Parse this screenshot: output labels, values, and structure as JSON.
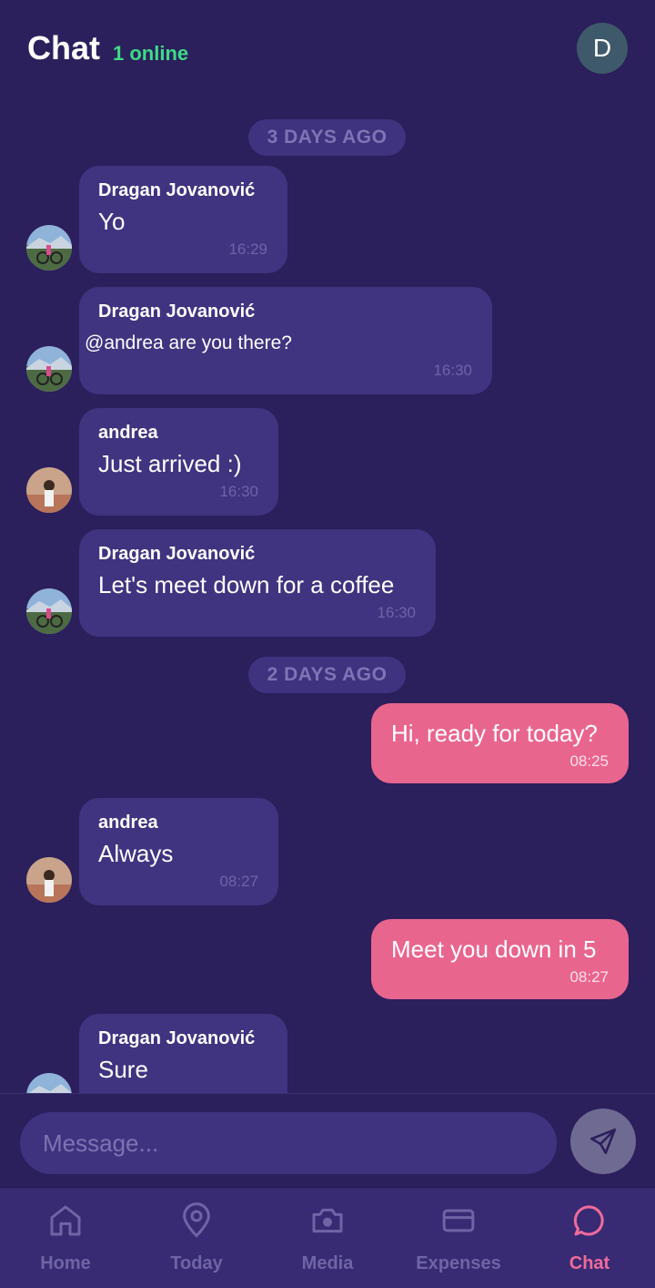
{
  "header": {
    "title": "Chat",
    "online_status": "1 online",
    "user_initial": "D"
  },
  "day_separators": [
    "3 DAYS AGO",
    "2 DAYS AGO"
  ],
  "messages": [
    {
      "sender": "Dragan Jovanović",
      "text": "Yo",
      "time": "16:29",
      "direction": "in"
    },
    {
      "sender": "Dragan Jovanović",
      "text": "@andrea are you there?",
      "time": "16:30",
      "direction": "in"
    },
    {
      "sender": "andrea",
      "text": "Just arrived :)",
      "time": "16:30",
      "direction": "in"
    },
    {
      "sender": "Dragan Jovanović",
      "text": "Let's meet down for a coffee",
      "time": "16:30",
      "direction": "in"
    },
    {
      "sender": "",
      "text": "Hi, ready for today?",
      "time": "08:25",
      "direction": "out"
    },
    {
      "sender": "andrea",
      "text": "Always",
      "time": "08:27",
      "direction": "in"
    },
    {
      "sender": "",
      "text": "Meet you down in 5",
      "time": "08:27",
      "direction": "out"
    },
    {
      "sender": "Dragan Jovanović",
      "text": "Sure",
      "time": "",
      "direction": "in"
    }
  ],
  "composer": {
    "placeholder": "Message..."
  },
  "tabs": [
    {
      "label": "Home",
      "icon": "home-icon"
    },
    {
      "label": "Today",
      "icon": "map-pin-icon"
    },
    {
      "label": "Media",
      "icon": "camera-icon"
    },
    {
      "label": "Expenses",
      "icon": "credit-card-icon"
    },
    {
      "label": "Chat",
      "icon": "chat-bubble-icon",
      "active": true
    }
  ],
  "colors": {
    "background": "#2b1f5c",
    "bubble_in": "#40337f",
    "bubble_out": "#e8658e",
    "online": "#3ddc84",
    "active_tab": "#ef6b9b"
  }
}
